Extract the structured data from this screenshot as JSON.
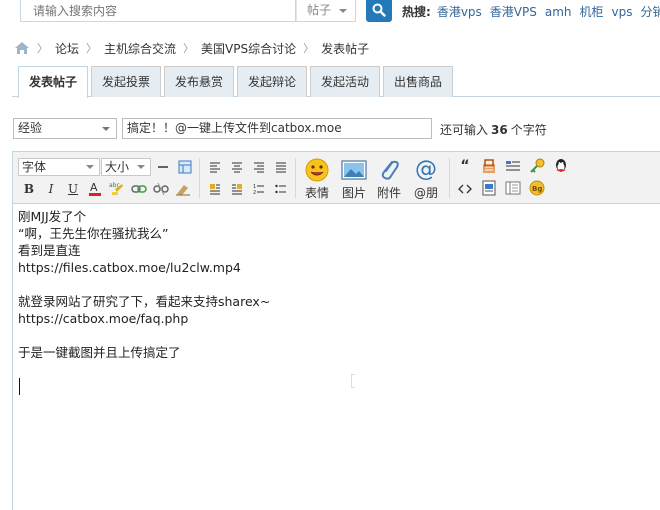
{
  "search": {
    "placeholder": "请输入搜索内容",
    "type_value": "帖子"
  },
  "hot": {
    "label": "热搜:",
    "items": [
      "香港vps",
      "香港VPS",
      "amh",
      "机柜",
      "vps",
      "分销"
    ]
  },
  "breadcrumb": {
    "items": [
      "论坛",
      "主机综合交流",
      "美国VPS综合讨论",
      "发表帖子"
    ]
  },
  "tabs": [
    {
      "label": "发表帖子",
      "active": true
    },
    {
      "label": "发起投票"
    },
    {
      "label": "发布悬赏"
    },
    {
      "label": "发起辩论"
    },
    {
      "label": "发起活动"
    },
    {
      "label": "出售商品"
    }
  ],
  "post": {
    "type_value": "经验",
    "subject": "搞定！！@一键上传文件到catbox.moe",
    "remaining_prefix": "还可输入",
    "remaining_count": "36",
    "remaining_suffix": "个字符"
  },
  "toolbar": {
    "font_label": "字体",
    "size_label": "大小",
    "emoji_label": "表情",
    "image_label": "图片",
    "attach_label": "附件",
    "mention_label": "@朋"
  },
  "content": {
    "lines": [
      "刚MJJ发了个",
      "“啊，王先生你在骚扰我么”",
      "看到是直连",
      "https://files.catbox.moe/lu2clw.mp4",
      "",
      "就登录网站了研究了下，看起来支持sharex~",
      "https://catbox.moe/faq.php",
      "",
      "于是一键截图并且上传搞定了"
    ]
  },
  "colors": {
    "accent": "#2479b8",
    "link": "#336699",
    "tab_bg": "#e5edf2",
    "border": "#c2d5e3"
  }
}
